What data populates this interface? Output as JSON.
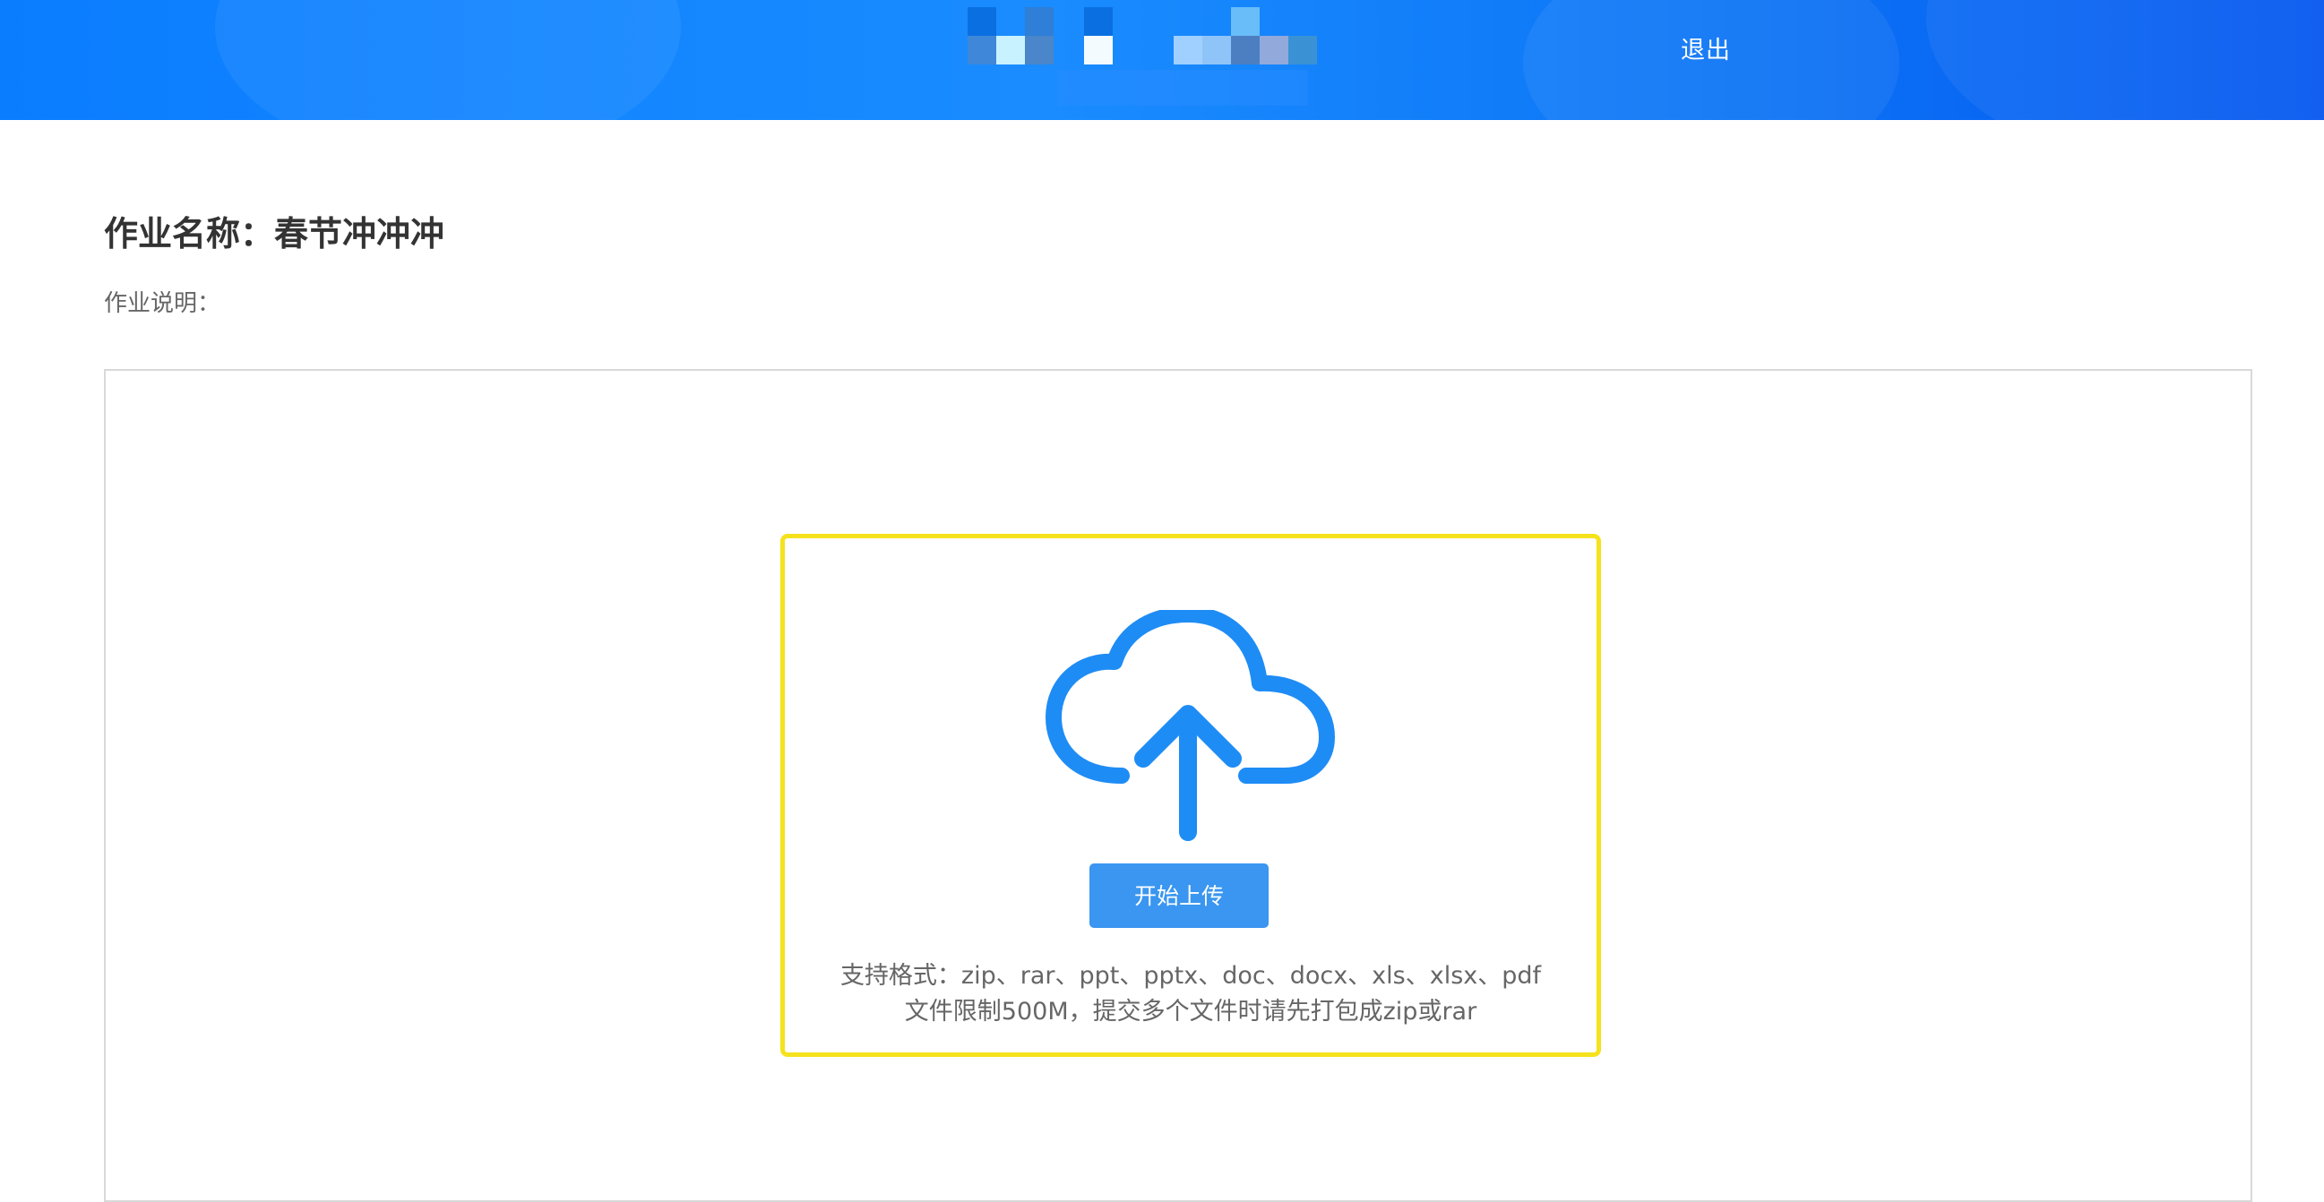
{
  "header": {
    "logout_label": "退出",
    "background_colors": [
      "#0a7dff",
      "#0557f0"
    ],
    "logo": "pixelated-logo"
  },
  "assignment": {
    "title": "作业名称：春节冲冲冲",
    "description_label": "作业说明："
  },
  "upload": {
    "icon": "cloud-upload-icon",
    "icon_color": "#1e8cf5",
    "button_label": "开始上传",
    "button_color": "#3a96f0",
    "formats_text": "支持格式：zip、rar、ppt、pptx、doc、docx、xls、xlsx、pdf",
    "limit_text": "文件限制500M，提交多个文件时请先打包成zip或rar",
    "highlight_color": "#f5e21c"
  }
}
